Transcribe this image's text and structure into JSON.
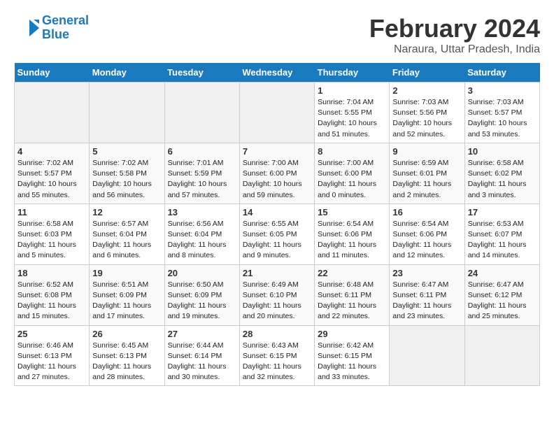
{
  "logo": {
    "line1": "General",
    "line2": "Blue"
  },
  "title": "February 2024",
  "subtitle": "Naraura, Uttar Pradesh, India",
  "weekdays": [
    "Sunday",
    "Monday",
    "Tuesday",
    "Wednesday",
    "Thursday",
    "Friday",
    "Saturday"
  ],
  "weeks": [
    [
      {
        "day": "",
        "info": ""
      },
      {
        "day": "",
        "info": ""
      },
      {
        "day": "",
        "info": ""
      },
      {
        "day": "",
        "info": ""
      },
      {
        "day": "1",
        "info": "Sunrise: 7:04 AM\nSunset: 5:55 PM\nDaylight: 10 hours\nand 51 minutes."
      },
      {
        "day": "2",
        "info": "Sunrise: 7:03 AM\nSunset: 5:56 PM\nDaylight: 10 hours\nand 52 minutes."
      },
      {
        "day": "3",
        "info": "Sunrise: 7:03 AM\nSunset: 5:57 PM\nDaylight: 10 hours\nand 53 minutes."
      }
    ],
    [
      {
        "day": "4",
        "info": "Sunrise: 7:02 AM\nSunset: 5:57 PM\nDaylight: 10 hours\nand 55 minutes."
      },
      {
        "day": "5",
        "info": "Sunrise: 7:02 AM\nSunset: 5:58 PM\nDaylight: 10 hours\nand 56 minutes."
      },
      {
        "day": "6",
        "info": "Sunrise: 7:01 AM\nSunset: 5:59 PM\nDaylight: 10 hours\nand 57 minutes."
      },
      {
        "day": "7",
        "info": "Sunrise: 7:00 AM\nSunset: 6:00 PM\nDaylight: 10 hours\nand 59 minutes."
      },
      {
        "day": "8",
        "info": "Sunrise: 7:00 AM\nSunset: 6:00 PM\nDaylight: 11 hours\nand 0 minutes."
      },
      {
        "day": "9",
        "info": "Sunrise: 6:59 AM\nSunset: 6:01 PM\nDaylight: 11 hours\nand 2 minutes."
      },
      {
        "day": "10",
        "info": "Sunrise: 6:58 AM\nSunset: 6:02 PM\nDaylight: 11 hours\nand 3 minutes."
      }
    ],
    [
      {
        "day": "11",
        "info": "Sunrise: 6:58 AM\nSunset: 6:03 PM\nDaylight: 11 hours\nand 5 minutes."
      },
      {
        "day": "12",
        "info": "Sunrise: 6:57 AM\nSunset: 6:04 PM\nDaylight: 11 hours\nand 6 minutes."
      },
      {
        "day": "13",
        "info": "Sunrise: 6:56 AM\nSunset: 6:04 PM\nDaylight: 11 hours\nand 8 minutes."
      },
      {
        "day": "14",
        "info": "Sunrise: 6:55 AM\nSunset: 6:05 PM\nDaylight: 11 hours\nand 9 minutes."
      },
      {
        "day": "15",
        "info": "Sunrise: 6:54 AM\nSunset: 6:06 PM\nDaylight: 11 hours\nand 11 minutes."
      },
      {
        "day": "16",
        "info": "Sunrise: 6:54 AM\nSunset: 6:06 PM\nDaylight: 11 hours\nand 12 minutes."
      },
      {
        "day": "17",
        "info": "Sunrise: 6:53 AM\nSunset: 6:07 PM\nDaylight: 11 hours\nand 14 minutes."
      }
    ],
    [
      {
        "day": "18",
        "info": "Sunrise: 6:52 AM\nSunset: 6:08 PM\nDaylight: 11 hours\nand 15 minutes."
      },
      {
        "day": "19",
        "info": "Sunrise: 6:51 AM\nSunset: 6:09 PM\nDaylight: 11 hours\nand 17 minutes."
      },
      {
        "day": "20",
        "info": "Sunrise: 6:50 AM\nSunset: 6:09 PM\nDaylight: 11 hours\nand 19 minutes."
      },
      {
        "day": "21",
        "info": "Sunrise: 6:49 AM\nSunset: 6:10 PM\nDaylight: 11 hours\nand 20 minutes."
      },
      {
        "day": "22",
        "info": "Sunrise: 6:48 AM\nSunset: 6:11 PM\nDaylight: 11 hours\nand 22 minutes."
      },
      {
        "day": "23",
        "info": "Sunrise: 6:47 AM\nSunset: 6:11 PM\nDaylight: 11 hours\nand 23 minutes."
      },
      {
        "day": "24",
        "info": "Sunrise: 6:47 AM\nSunset: 6:12 PM\nDaylight: 11 hours\nand 25 minutes."
      }
    ],
    [
      {
        "day": "25",
        "info": "Sunrise: 6:46 AM\nSunset: 6:13 PM\nDaylight: 11 hours\nand 27 minutes."
      },
      {
        "day": "26",
        "info": "Sunrise: 6:45 AM\nSunset: 6:13 PM\nDaylight: 11 hours\nand 28 minutes."
      },
      {
        "day": "27",
        "info": "Sunrise: 6:44 AM\nSunset: 6:14 PM\nDaylight: 11 hours\nand 30 minutes."
      },
      {
        "day": "28",
        "info": "Sunrise: 6:43 AM\nSunset: 6:15 PM\nDaylight: 11 hours\nand 32 minutes."
      },
      {
        "day": "29",
        "info": "Sunrise: 6:42 AM\nSunset: 6:15 PM\nDaylight: 11 hours\nand 33 minutes."
      },
      {
        "day": "",
        "info": ""
      },
      {
        "day": "",
        "info": ""
      }
    ]
  ]
}
